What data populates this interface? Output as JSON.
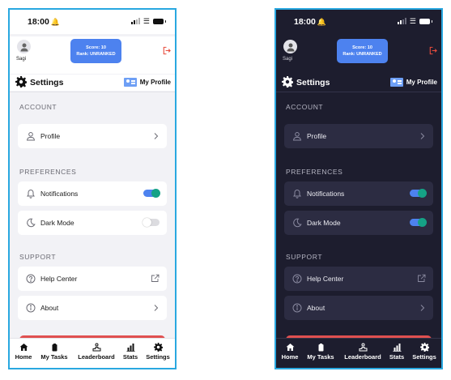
{
  "status_bar": {
    "time": "18:00",
    "bell_glyph": "🔔"
  },
  "header": {
    "username": "Sagi",
    "score_line": "Score: 10",
    "rank_line": "Rank: UNRANKED",
    "logout_icon": "logout-icon",
    "accent_color": "#4d82ef",
    "logout_color": "#e84c3d"
  },
  "title_bar": {
    "title": "Settings",
    "profile_link": "My Profile"
  },
  "sections": {
    "account": {
      "header": "ACCOUNT",
      "items": [
        {
          "label": "Profile",
          "icon": "person-icon"
        }
      ]
    },
    "preferences": {
      "header": "PREFERENCES",
      "items": [
        {
          "label": "Notifications",
          "icon": "bell-icon"
        },
        {
          "label": "Dark Mode",
          "icon": "moon-icon"
        }
      ]
    },
    "support": {
      "header": "SUPPORT",
      "items": [
        {
          "label": "Help Center",
          "icon": "help-circle-icon"
        },
        {
          "label": "About",
          "icon": "info-icon"
        }
      ]
    }
  },
  "toggles": {
    "light_mode_screen": {
      "notifications": true,
      "dark_mode": false
    },
    "dark_mode_screen": {
      "notifications": true,
      "dark_mode": true
    }
  },
  "tab_bar": {
    "tabs": [
      {
        "label": "Home",
        "icon": "home-icon"
      },
      {
        "label": "My Tasks",
        "icon": "tasks-icon"
      },
      {
        "label": "Leaderboard",
        "icon": "leaderboard-icon"
      },
      {
        "label": "Stats",
        "icon": "stats-icon"
      },
      {
        "label": "Settings",
        "icon": "settings-gear-icon"
      }
    ]
  },
  "colors": {
    "light_background": "#f2f2f6",
    "dark_background": "#1d1d2e",
    "dark_card": "#2c2c42",
    "toggle_on": "#4d82ef",
    "toggle_knob_on": "#15a286",
    "danger_bar": "#e05050",
    "frame_border": "#29a8e0"
  }
}
